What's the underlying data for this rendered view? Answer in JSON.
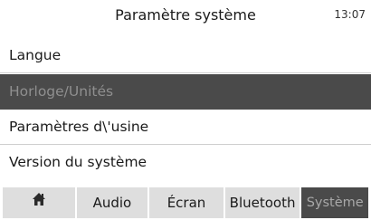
{
  "header": {
    "title": "Paramètre système",
    "time": "13:07"
  },
  "menu": {
    "items": [
      {
        "label": "Langue"
      },
      {
        "label": "Horloge/Unités"
      },
      {
        "label": "Paramètres d\\'usine"
      },
      {
        "label": "Version du système"
      }
    ],
    "selected_index": 1
  },
  "tabs": [
    {
      "label": "",
      "icon": "home-icon"
    },
    {
      "label": "Audio"
    },
    {
      "label": "Écran"
    },
    {
      "label": "Bluetooth"
    },
    {
      "label": "Système"
    }
  ],
  "colors": {
    "selected_bg": "#4a4a4a",
    "tab_bg": "#dedede",
    "background": "#ffffff"
  }
}
